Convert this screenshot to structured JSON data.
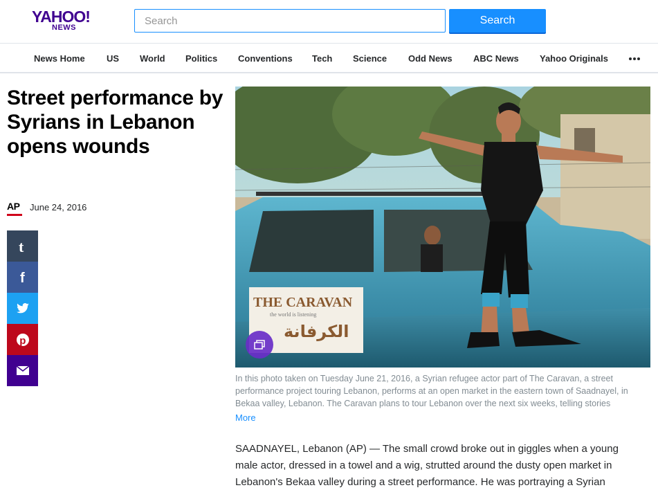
{
  "header": {
    "logo_main": "YAHOO!",
    "logo_sub": "NEWS",
    "search_placeholder": "Search",
    "search_button": "Search"
  },
  "nav": {
    "items": [
      "News Home",
      "US",
      "World",
      "Politics",
      "Conventions",
      "Tech",
      "Science",
      "Odd News",
      "ABC News",
      "Yahoo Originals"
    ],
    "more_icon": "ellipsis-icon"
  },
  "article": {
    "headline": "Street performance by Syrians in Lebanon opens wounds",
    "source": "AP",
    "date": "June 24, 2016",
    "photo_sign_title": "THE CARAVAN",
    "photo_sign_sub": "the world is listening",
    "photo_sign_arabic": "الكرفانة",
    "caption": "In this photo taken on Tuesday June 21, 2016, a Syrian refugee actor part of The Caravan, a street performance project touring Lebanon, performs at an open market in the eastern town of Saadnayel, in Bekaa valley, Lebanon. The Caravan plans to tour Lebanon over the next six weeks, telling stories",
    "caption_more": "More",
    "body": "SAADNAYEL, Lebanon (AP) — The small crowd broke out in giggles when a young male actor, dressed in a towel and a wig, strutted around the dusty open market in Lebanon's Bekaa valley during a street performance. He was portraying a Syrian"
  },
  "share": [
    {
      "name": "tumblr",
      "icon": "tumblr-icon",
      "color": "#35465c"
    },
    {
      "name": "facebook",
      "icon": "facebook-icon",
      "color": "#3b5998"
    },
    {
      "name": "twitter",
      "icon": "twitter-icon",
      "color": "#1da1f2"
    },
    {
      "name": "pinterest",
      "icon": "pinterest-icon",
      "color": "#bd081c"
    },
    {
      "name": "email",
      "icon": "mail-icon",
      "color": "#400090"
    }
  ],
  "colors": {
    "brand": "#400090",
    "accent": "#188fff",
    "ap_red": "#d0021b"
  }
}
